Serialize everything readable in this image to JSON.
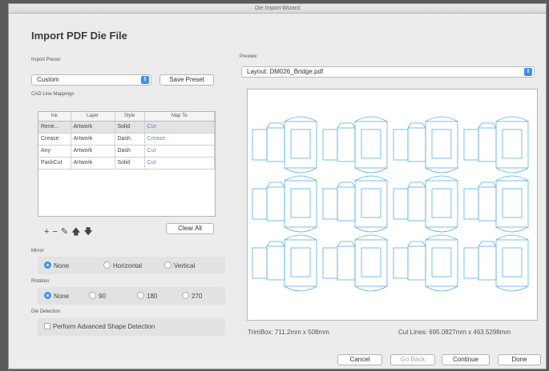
{
  "window": {
    "title": "Die Import Wizard"
  },
  "heading": "Import PDF Die File",
  "import_preset": {
    "label": "Import Preset",
    "value": "Custom",
    "save_button": "Save Preset"
  },
  "mappings": {
    "label": "CAD Line Mappings",
    "columns": [
      "Ink",
      "Layer",
      "Style",
      "Map To"
    ],
    "rows": [
      {
        "ink": "Rene...",
        "layer": "Artwork",
        "style": "Solid",
        "map_to": "Cut",
        "map_color": "#3d8ef0"
      },
      {
        "ink": "Crease",
        "layer": "Artwork",
        "style": "Dash",
        "map_to": "Crease",
        "map_color": "#4caf50"
      },
      {
        "ink": "Any",
        "layer": "Artwork",
        "style": "Dash",
        "map_to": "Cut",
        "map_color": "#3d8ef0"
      },
      {
        "ink": "PackCut",
        "layer": "Artwork",
        "style": "Solid",
        "map_to": "Cut",
        "map_color": "#3d8ef0"
      }
    ],
    "clear_all": "Clear All"
  },
  "mirror": {
    "label": "Mirror",
    "options": [
      "None",
      "Horizontal",
      "Vertical"
    ],
    "selected": "None"
  },
  "rotation": {
    "label": "Rotation",
    "options": [
      "None",
      "90",
      "180",
      "270"
    ],
    "selected": "None"
  },
  "detection": {
    "label": "Die Detection",
    "checkbox": "Perform Advanced Shape Detection",
    "checked": false
  },
  "preview": {
    "label": "Preview",
    "layout": "Layout: DM026_Bridge.pdf"
  },
  "footer": {
    "trimbox": "TrimBox:  711.2mm x 508mm",
    "cutlines": "Cut Lines:  695.0827mm x 463.5298mm"
  },
  "buttons": {
    "cancel": "Cancel",
    "go_back": "Go Back",
    "continue": "Continue",
    "done": "Done"
  },
  "colors": {
    "accent": "#3d8ef0",
    "die_line": "#5aaee6"
  }
}
